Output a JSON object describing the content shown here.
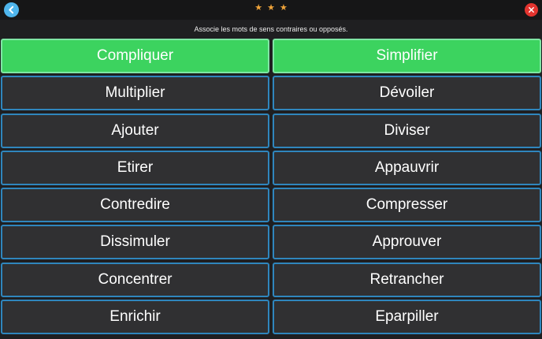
{
  "header": {
    "stars": [
      "★",
      "★",
      "★"
    ],
    "back_icon": "chevron-left-icon",
    "close_icon": "close-icon",
    "colors": {
      "back": "#4fb5ec",
      "close": "#e3342f",
      "stars": "#f0a43a"
    }
  },
  "instruction": "Associe les mots de sens contraires ou opposés.",
  "left_words": [
    "Compliquer",
    "Multiplier",
    "Ajouter",
    "Etirer",
    "Contredire",
    "Dissimuler",
    "Concentrer",
    "Enrichir"
  ],
  "right_words": [
    "Simplifier",
    "Dévoiler",
    "Diviser",
    "Appauvrir",
    "Compresser",
    "Approuver",
    "Retrancher",
    "Eparpiller"
  ],
  "selected": {
    "left": "Compliquer",
    "right": "Simplifier"
  },
  "colors": {
    "selected": "#3cd35f",
    "tile": "#303032",
    "tile_border": "#2f86bd"
  }
}
